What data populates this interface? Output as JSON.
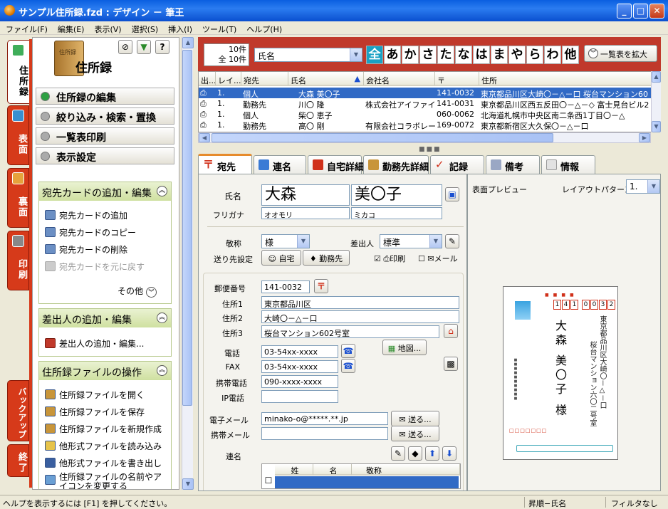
{
  "window": {
    "title": "サンプル住所録.fzd : デザイン － 筆王"
  },
  "menu": [
    "ファイル(F)",
    "編集(E)",
    "表示(V)",
    "選択(S)",
    "挿入(I)",
    "ツール(T)",
    "ヘルプ(H)"
  ],
  "side_tabs": [
    "住所録",
    "表面",
    "裏面",
    "印刷",
    "バックアップ",
    "終了"
  ],
  "left": {
    "header_title": "住所録",
    "book_label": "住所録",
    "nav": [
      "住所録の編集",
      "絞り込み・検索・置換",
      "一覧表印刷",
      "表示設定"
    ],
    "sections": [
      {
        "title": "宛先カードの追加・編集",
        "items": [
          "宛先カードの追加",
          "宛先カードのコピー",
          "宛先カードの削除",
          "宛先カードを元に戻す"
        ],
        "more": "その他"
      },
      {
        "title": "差出人の追加・編集",
        "items": [
          "差出人の追加・編集..."
        ]
      },
      {
        "title": "住所録ファイルの操作",
        "items": [
          "住所録ファイルを開く",
          "住所録ファイルを保存",
          "住所録ファイルを新規作成",
          "他形式ファイルを読み込み",
          "他形式ファイルを書き出し",
          "住所録ファイルの名前やアイコンを変更する"
        ]
      }
    ]
  },
  "list": {
    "count_filtered": "10件",
    "count_total": "全 10件",
    "sort_field": "氏名",
    "kana": [
      "全",
      "あ",
      "か",
      "さ",
      "た",
      "な",
      "は",
      "ま",
      "や",
      "ら",
      "わ",
      "他"
    ],
    "expand_button": "一覧表を拡大",
    "columns": [
      "出...",
      "レイ...",
      "宛先",
      "氏名",
      "▲",
      "会社名",
      "〒",
      "住所"
    ],
    "rows": [
      [
        "1.",
        "個人",
        "大森 美〇子",
        "",
        "141-0032",
        "東京都品川区大崎〇－△－口 桜台マンション60"
      ],
      [
        "1.",
        "勤務先",
        "川〇 隆",
        "株式会社アイファイブ",
        "141-0031",
        "東京都品川区西五反田〇－△－◇ 富士見台ビル2"
      ],
      [
        "1.",
        "個人",
        "柴〇 恵子",
        "",
        "060-0062",
        "北海道札幌市中央区南二条西1丁目〇－△"
      ],
      [
        "1.",
        "勤務先",
        "高〇 剛",
        "有限会社コラボレー...",
        "169-0072",
        "東京都新宿区大久保〇－△－口"
      ]
    ]
  },
  "tabs": [
    "宛先",
    "連名",
    "自宅詳細",
    "勤務先詳細",
    "記録",
    "備考",
    "情報"
  ],
  "form": {
    "name_label": "氏名",
    "last_name": "大森",
    "first_name": "美〇子",
    "furigana_label": "フリガナ",
    "last_kana": "オオモリ",
    "first_kana": "ミカコ",
    "honorific_label": "敬称",
    "honorific": "様",
    "sender_label": "差出人",
    "sender": "標準",
    "dest_label": "送り先設定",
    "home_btn": "自宅",
    "work_btn": "勤務先",
    "print_check": "印刷",
    "mail_check": "メール",
    "zip_label": "郵便番号",
    "zip": "141-0032",
    "addr1_label": "住所1",
    "addr1": "東京都品川区",
    "addr2_label": "住所2",
    "addr2": "大崎〇－△－口",
    "addr3_label": "住所3",
    "addr3": "桜台マンション602号室",
    "tel_label": "電話",
    "tel": "03-54xx-xxxx",
    "fax_label": "FAX",
    "fax": "03-54xx-xxxx",
    "map_btn": "地図...",
    "mobile_label": "携帯電話",
    "mobile": "090-xxxx-xxxx",
    "ip_label": "IP電話",
    "email_label": "電子メール",
    "email": "minako-o@*****.**.jp",
    "send_btn": "送る...",
    "mobile_mail_label": "携帯メール",
    "renmei_label": "連名",
    "renmei_cols": [
      "姓",
      "名",
      "敬称"
    ]
  },
  "preview": {
    "label": "表面プレビュー",
    "layout_label": "レイアウトパターン",
    "layout_value": "1.",
    "card_zip": "1410032",
    "card_addr_line1": "東京都品川区大崎〇－△－口",
    "card_addr_line2": "桜台マンション六〇二号室",
    "card_name": "大森 美〇子 様"
  },
  "status": {
    "help": "ヘルプを表示するには [F1] を押してください。",
    "sort": "昇順−氏名",
    "filter": "フィルタなし"
  }
}
